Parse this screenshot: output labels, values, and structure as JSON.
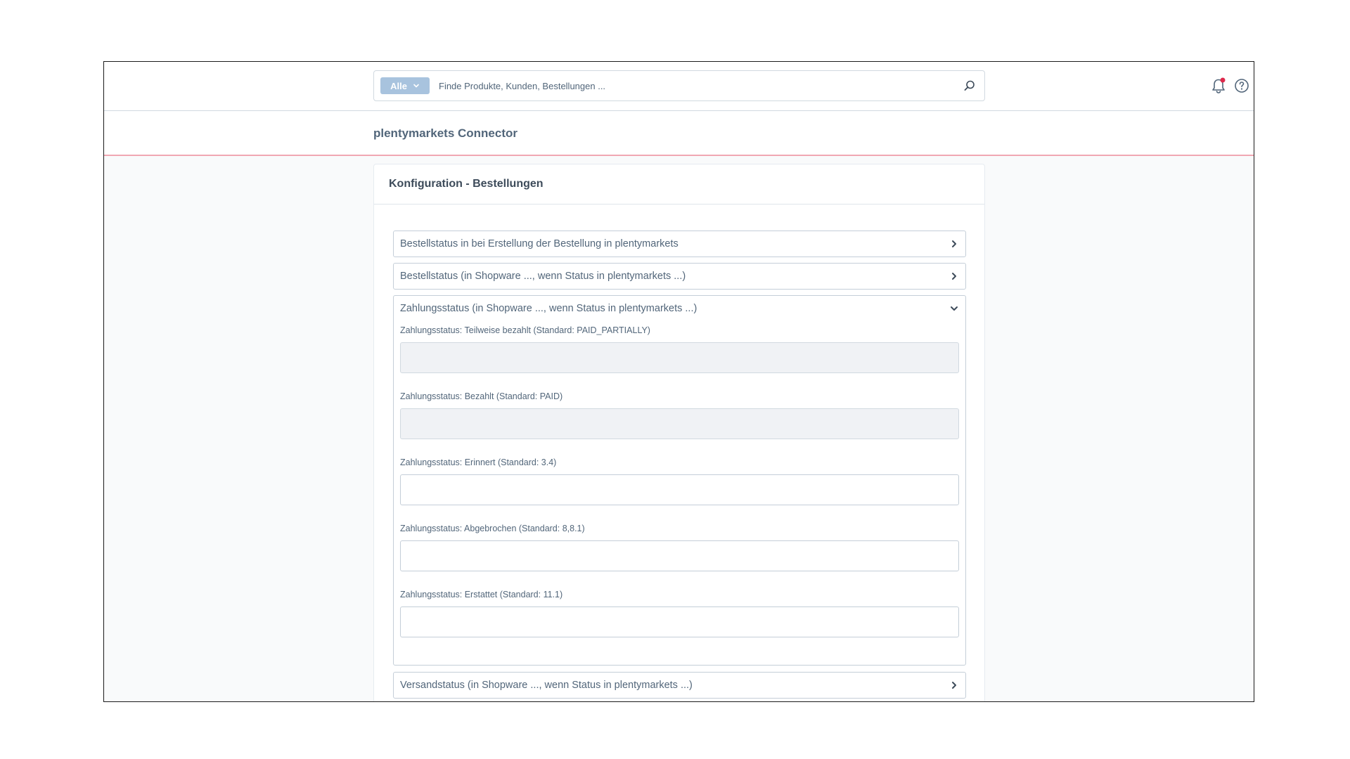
{
  "search": {
    "type_label": "Alle",
    "placeholder": "Finde Produkte, Kunden, Bestellungen ..."
  },
  "header": {
    "title": "plentymarkets Connector"
  },
  "card": {
    "title": "Konfiguration - Bestellungen"
  },
  "accordion": [
    {
      "label": "Bestellstatus in bei Erstellung der Bestellung in plentymarkets",
      "expanded": false
    },
    {
      "label": "Bestellstatus (in Shopware ..., wenn Status in plentymarkets ...)",
      "expanded": false
    },
    {
      "label": "Zahlungsstatus (in Shopware ..., wenn Status in plentymarkets ...)",
      "expanded": true
    },
    {
      "label": "Versandstatus (in Shopware ..., wenn Status in plentymarkets ...)",
      "expanded": false
    }
  ],
  "payment_fields": [
    {
      "label": "Zahlungsstatus: Teilweise bezahlt (Standard: PAID_PARTIALLY)",
      "value": "",
      "disabled": true
    },
    {
      "label": "Zahlungsstatus: Bezahlt (Standard: PAID)",
      "value": "",
      "disabled": true
    },
    {
      "label": "Zahlungsstatus: Erinnert (Standard: 3.4)",
      "value": "",
      "disabled": false
    },
    {
      "label": "Zahlungsstatus: Abgebrochen (Standard: 8,8.1)",
      "value": "",
      "disabled": false
    },
    {
      "label": "Zahlungsstatus: Erstattet (Standard: 11.1)",
      "value": "",
      "disabled": false
    }
  ],
  "icons": {
    "search": "search-icon",
    "notifications": "bell-icon",
    "help": "help-icon",
    "notification_dot_color": "#de294c"
  }
}
